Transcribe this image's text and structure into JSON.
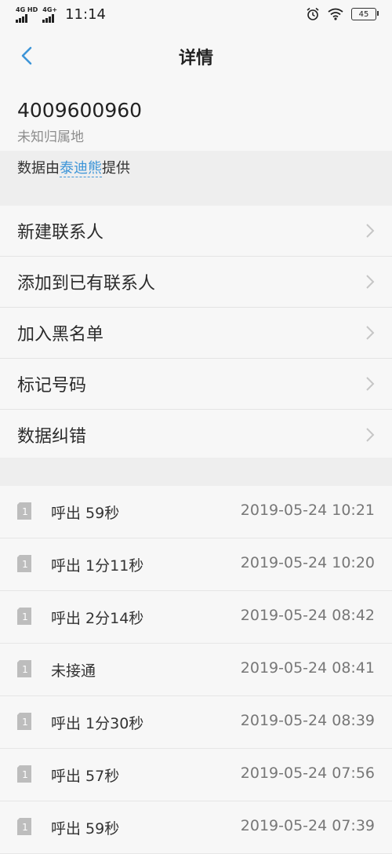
{
  "status_bar": {
    "signal1_tag": "4G HD",
    "signal2_tag": "4G+",
    "time": "11:14",
    "battery": "45",
    "icons": [
      "alarm-icon",
      "wifi-icon",
      "battery-icon"
    ]
  },
  "nav": {
    "title": "详情",
    "back_icon": "back-chevron-icon"
  },
  "contact": {
    "number": "4009600960",
    "location": "未知归属地"
  },
  "data_source": {
    "prefix": "数据由",
    "provider": "泰迪熊",
    "suffix": "提供"
  },
  "actions": [
    {
      "label": "新建联系人"
    },
    {
      "label": "添加到已有联系人"
    },
    {
      "label": "加入黑名单"
    },
    {
      "label": "标记号码"
    },
    {
      "label": "数据纠错"
    }
  ],
  "calls": [
    {
      "sim": "1",
      "desc": "呼出 59秒",
      "time": "2019-05-24 10:21"
    },
    {
      "sim": "1",
      "desc": "呼出 1分11秒",
      "time": "2019-05-24 10:20"
    },
    {
      "sim": "1",
      "desc": "呼出 2分14秒",
      "time": "2019-05-24 08:42"
    },
    {
      "sim": "1",
      "desc": "未接通",
      "time": "2019-05-24 08:41"
    },
    {
      "sim": "1",
      "desc": "呼出 1分30秒",
      "time": "2019-05-24 08:39"
    },
    {
      "sim": "1",
      "desc": "呼出 57秒",
      "time": "2019-05-24 07:56"
    },
    {
      "sim": "1",
      "desc": "呼出 59秒",
      "time": "2019-05-24 07:39"
    }
  ],
  "colors": {
    "accent": "#3d95d8",
    "background": "#f5f5f5",
    "separator": "#eeeeee"
  }
}
